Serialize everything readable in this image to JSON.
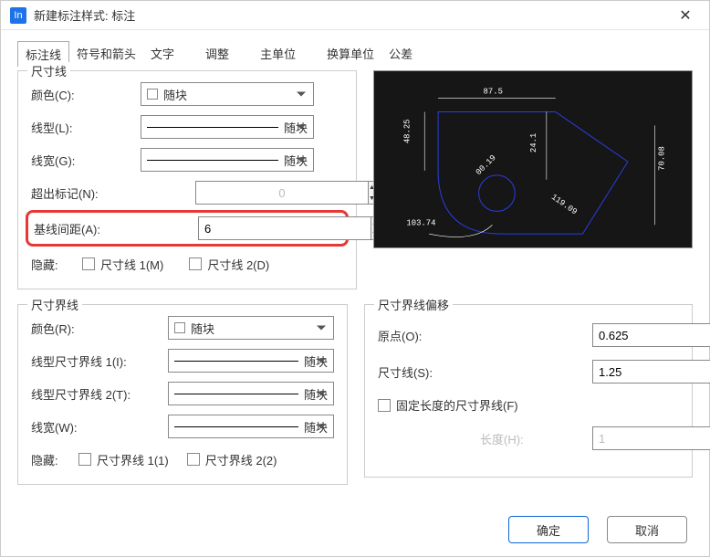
{
  "titlebar": {
    "app_icon_text": "In",
    "title": "新建标注样式: 标注"
  },
  "tabs": {
    "t0": "标注线",
    "t1": "符号和箭头",
    "t2": "文字",
    "t3": "调整",
    "t4": "主单位",
    "t5": "换算单位",
    "t6": "公差"
  },
  "dim_line": {
    "legend": "尺寸线",
    "color_label": "颜色(C):",
    "color_value": "随块",
    "linetype_label": "线型(L):",
    "linetype_value": "随块",
    "lineweight_label": "线宽(G):",
    "lineweight_value": "随块",
    "extend_label": "超出标记(N):",
    "extend_value": "0",
    "baseline_label": "基线间距(A):",
    "baseline_value": "6",
    "hide_label": "隐藏:",
    "hide_dim1": "尺寸线 1(M)",
    "hide_dim2": "尺寸线 2(D)"
  },
  "ext_line": {
    "legend": "尺寸界线",
    "color_label": "颜色(R):",
    "color_value": "随块",
    "lt1_label": "线型尺寸界线 1(I):",
    "lt1_value": "随块",
    "lt2_label": "线型尺寸界线 2(T):",
    "lt2_value": "随块",
    "lw_label": "线宽(W):",
    "lw_value": "随块",
    "hide_label": "隐藏:",
    "hide1": "尺寸界线 1(1)",
    "hide2": "尺寸界线 2(2)"
  },
  "offset": {
    "legend": "尺寸界线偏移",
    "origin_label": "原点(O):",
    "origin_value": "0.625",
    "dimline_label": "尺寸线(S):",
    "dimline_value": "1.25",
    "fixed_label": "固定长度的尺寸界线(F)",
    "length_label": "长度(H):",
    "length_value": "1"
  },
  "preview": {
    "d1": "87.5",
    "d2": "48.25",
    "d3": "24.1",
    "d4": "70.08",
    "d5": "103.74",
    "d6": "00.19",
    "d7": "119.09"
  },
  "footer": {
    "ok": "确定",
    "cancel": "取消"
  }
}
